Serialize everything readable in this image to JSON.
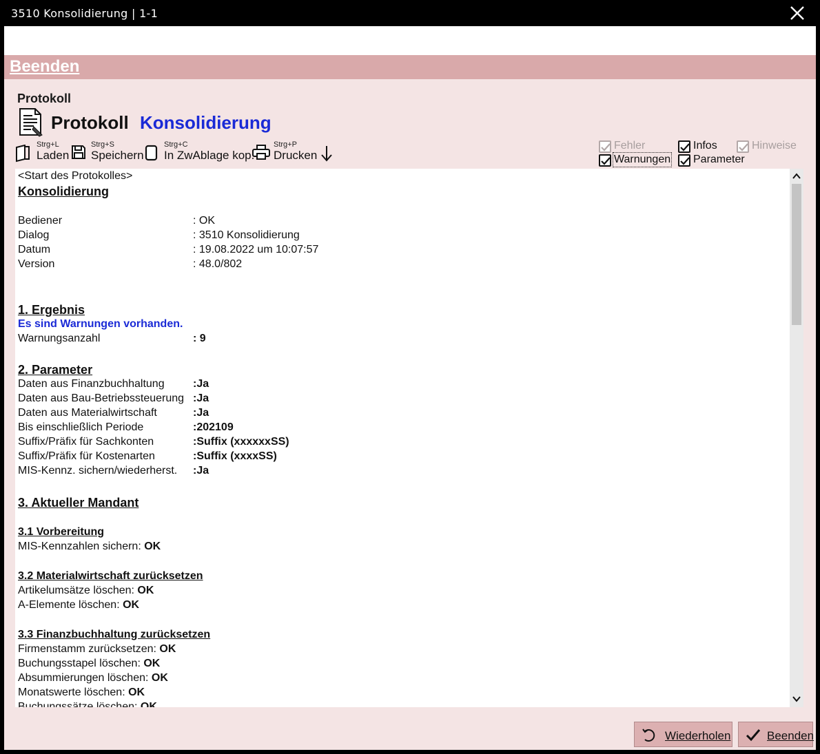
{
  "window": {
    "title": "3510 Konsolidierung | 1-1"
  },
  "menu": {
    "beenden": "Beenden"
  },
  "header": {
    "section": "Protokoll",
    "title_black": "Protokoll",
    "title_blue": "Konsolidierung"
  },
  "toolbar": {
    "laden": {
      "shortcut": "Strg+L",
      "label": "Laden"
    },
    "speichern": {
      "shortcut": "Strg+S",
      "label": "Speichern"
    },
    "kopieren": {
      "shortcut": "Strg+C",
      "label": "In ZwAblage kop."
    },
    "drucken": {
      "shortcut": "Strg+P",
      "label": "Drucken"
    }
  },
  "filters": {
    "fehler": {
      "label": "Fehler",
      "checked": true,
      "enabled": false
    },
    "infos": {
      "label": "Infos",
      "checked": true,
      "enabled": true
    },
    "hinweise": {
      "label": "Hinweise",
      "checked": true,
      "enabled": false
    },
    "warnungen": {
      "label": "Warnungen",
      "checked": true,
      "enabled": true
    },
    "parameter": {
      "label": "Parameter",
      "checked": true,
      "enabled": true
    }
  },
  "log": {
    "start": "<Start des Protokolles>",
    "heading": "Konsolidierung",
    "meta": [
      {
        "key": "Bediener",
        "value": ": OK"
      },
      {
        "key": "Dialog",
        "value": ": 3510 Konsolidierung"
      },
      {
        "key": "Datum",
        "value": ": 19.08.2022 um 10:07:57"
      },
      {
        "key": "Version",
        "value": ": 48.0/802"
      }
    ],
    "ergebnis": {
      "heading": "1. Ergebnis",
      "message": "Es sind Warnungen vorhanden.",
      "count_key": "Warnungsanzahl",
      "count_value": ": 9"
    },
    "parameter": {
      "heading": "2. Parameter",
      "rows": [
        {
          "key": "Daten aus Finanzbuchhaltung",
          "value": ":Ja"
        },
        {
          "key": "Daten aus Bau-Betriebssteuerung",
          "value": ":Ja"
        },
        {
          "key": "Daten aus Materialwirtschaft",
          "value": ":Ja"
        },
        {
          "key": "Bis einschließlich Periode",
          "value": ":202109"
        },
        {
          "key": "Suffix/Präfix für Sachkonten",
          "value": ":Suffix (xxxxxxSS)"
        },
        {
          "key": "Suffix/Präfix für Kostenarten",
          "value": ":Suffix (xxxxSS)"
        },
        {
          "key": "MIS-Kennz. sichern/wiederherst.",
          "value": ":Ja"
        }
      ]
    },
    "mandant": {
      "heading": "3. Aktueller Mandant"
    },
    "vorbereitung": {
      "heading": "3.1 Vorbereitung",
      "rows": [
        {
          "text": "MIS-Kennzahlen sichern:",
          "status": "OK"
        }
      ]
    },
    "material": {
      "heading": "3.2 Materialwirtschaft zurücksetzen",
      "rows": [
        {
          "text": "Artikelumsätze löschen:",
          "status": "OK"
        },
        {
          "text": "A-Elemente löschen:",
          "status": "OK"
        }
      ]
    },
    "fibu": {
      "heading": "3.3 Finanzbuchhaltung zurücksetzen",
      "rows": [
        {
          "text": "Firmenstamm zurücksetzen:",
          "status": "OK"
        },
        {
          "text": "Buchungsstapel löschen:",
          "status": "OK"
        },
        {
          "text": "Absummierungen löschen:",
          "status": "OK"
        },
        {
          "text": "Monatswerte löschen:",
          "status": "OK"
        },
        {
          "text": "Buchungssätze löschen:",
          "status": "OK"
        }
      ]
    }
  },
  "footer": {
    "wiederholen": "Wiederholen",
    "beenden": "Beenden"
  }
}
